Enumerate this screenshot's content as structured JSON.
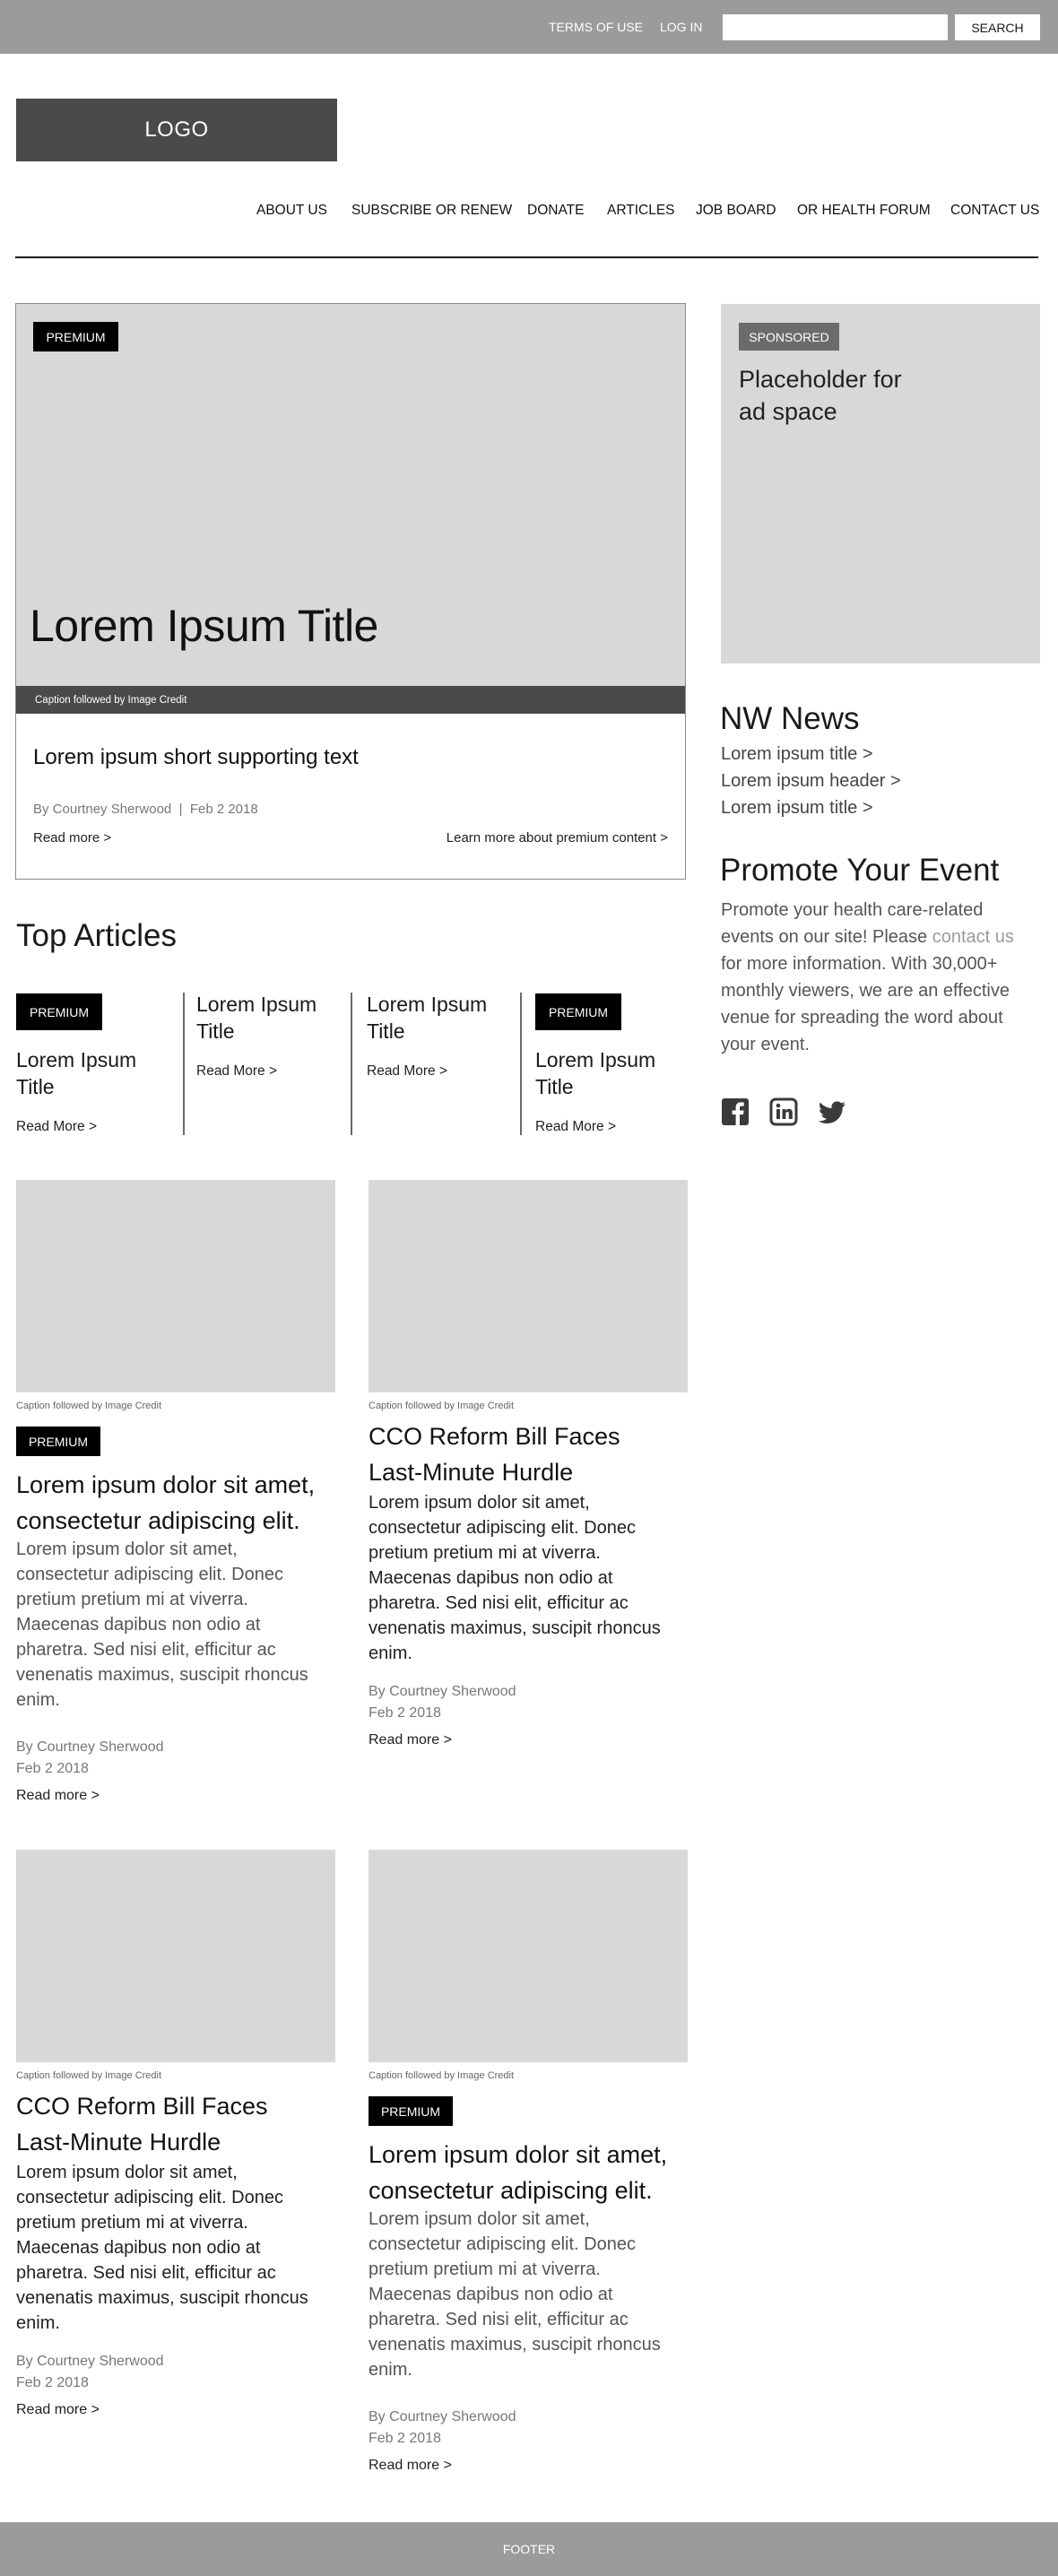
{
  "topbar": {
    "terms_label": "TERMS OF USE",
    "login_label": "LOG IN",
    "search_value": "",
    "search_button_label": "SEARCH"
  },
  "logo": {
    "label": "LOGO"
  },
  "nav": {
    "items": [
      "ABOUT US",
      "SUBSCRIBE OR RENEW",
      "DONATE",
      "ARTICLES",
      "JOB BOARD",
      "OR HEALTH FORUM",
      "CONTACT US"
    ]
  },
  "hero": {
    "badge": "PREMIUM",
    "title": "Lorem Ipsum Title",
    "caption": "Caption followed by Image Credit",
    "supporting_text": "Lorem ipsum short supporting text",
    "byline": "By Courtney Sherwood  |  Feb 2 2018",
    "read_more": "Read more >",
    "learn_more": "Learn more about premium content >"
  },
  "sidebar": {
    "ad": {
      "badge": "SPONSORED",
      "text": "Placeholder for ad space"
    },
    "nw_news": {
      "title": "NW News",
      "items": [
        "Lorem ipsum title >",
        "Lorem ipsum header >",
        "Lorem ipsum title >"
      ]
    },
    "promote": {
      "title": "Promote Your Event",
      "text_before": "Promote your health care-related events on our site! Please ",
      "link_text": "contact us",
      "text_after": " for more information. With 30,000+ monthly viewers, we are an effective venue for spreading the word about your event."
    },
    "social": [
      "facebook-icon",
      "linkedin-icon",
      "twitter-icon"
    ]
  },
  "top_articles": {
    "title": "Top Articles",
    "cards": [
      {
        "badge": "PREMIUM",
        "title": "Lorem Ipsum Title",
        "more": "Read More >"
      },
      {
        "title": "Lorem Ipsum Title",
        "more": "Read More >"
      },
      {
        "title": "Lorem Ipsum Title",
        "more": "Read More >"
      },
      {
        "badge": "PREMIUM",
        "title": "Lorem Ipsum Title",
        "more": "Read More >"
      }
    ]
  },
  "articles": [
    {
      "caption": "Caption followed by Image Credit",
      "badge": "PREMIUM",
      "title": "Lorem ipsum dolor sit amet, consectetur adipiscing elit.",
      "body": "Lorem ipsum dolor sit amet, consectetur adipiscing elit. Donec pretium pretium mi at viverra. Maecenas dapibus non odio at pharetra. Sed nisi elit, efficitur ac venenatis maximus, suscipit rhoncus enim.",
      "author": "By Courtney Sherwood",
      "date": "Feb 2 2018",
      "more": "Read more >"
    },
    {
      "caption": "Caption followed by Image Credit",
      "title": "CCO Reform Bill Faces Last-Minute Hurdle",
      "body": "Lorem ipsum dolor sit amet, consectetur adipiscing elit. Donec pretium pretium mi at viverra. Maecenas dapibus non odio at pharetra. Sed nisi elit, efficitur ac venenatis maximus, suscipit rhoncus enim.",
      "author": "By Courtney Sherwood",
      "date": "Feb 2 2018",
      "more": "Read more >"
    },
    {
      "caption": "Caption followed by Image Credit",
      "title": "CCO Reform Bill Faces Last-Minute Hurdle",
      "body": "Lorem ipsum dolor sit amet, consectetur adipiscing elit. Donec pretium pretium mi at viverra. Maecenas dapibus non odio at pharetra. Sed nisi elit, efficitur ac venenatis maximus, suscipit rhoncus enim.",
      "author": "By Courtney Sherwood",
      "date": "Feb 2 2018",
      "more": "Read more >"
    },
    {
      "caption": "Caption followed by Image Credit",
      "badge": "PREMIUM",
      "title": "Lorem ipsum dolor sit amet, consectetur adipiscing elit.",
      "body": "Lorem ipsum dolor sit amet, consectetur adipiscing elit. Donec pretium pretium mi at viverra. Maecenas dapibus non odio at pharetra. Sed nisi elit, efficitur ac venenatis maximus, suscipit rhoncus enim.",
      "author": "By Courtney Sherwood",
      "date": "Feb 2 2018",
      "more": "Read more >"
    }
  ],
  "footer": {
    "label": "FOOTER"
  }
}
